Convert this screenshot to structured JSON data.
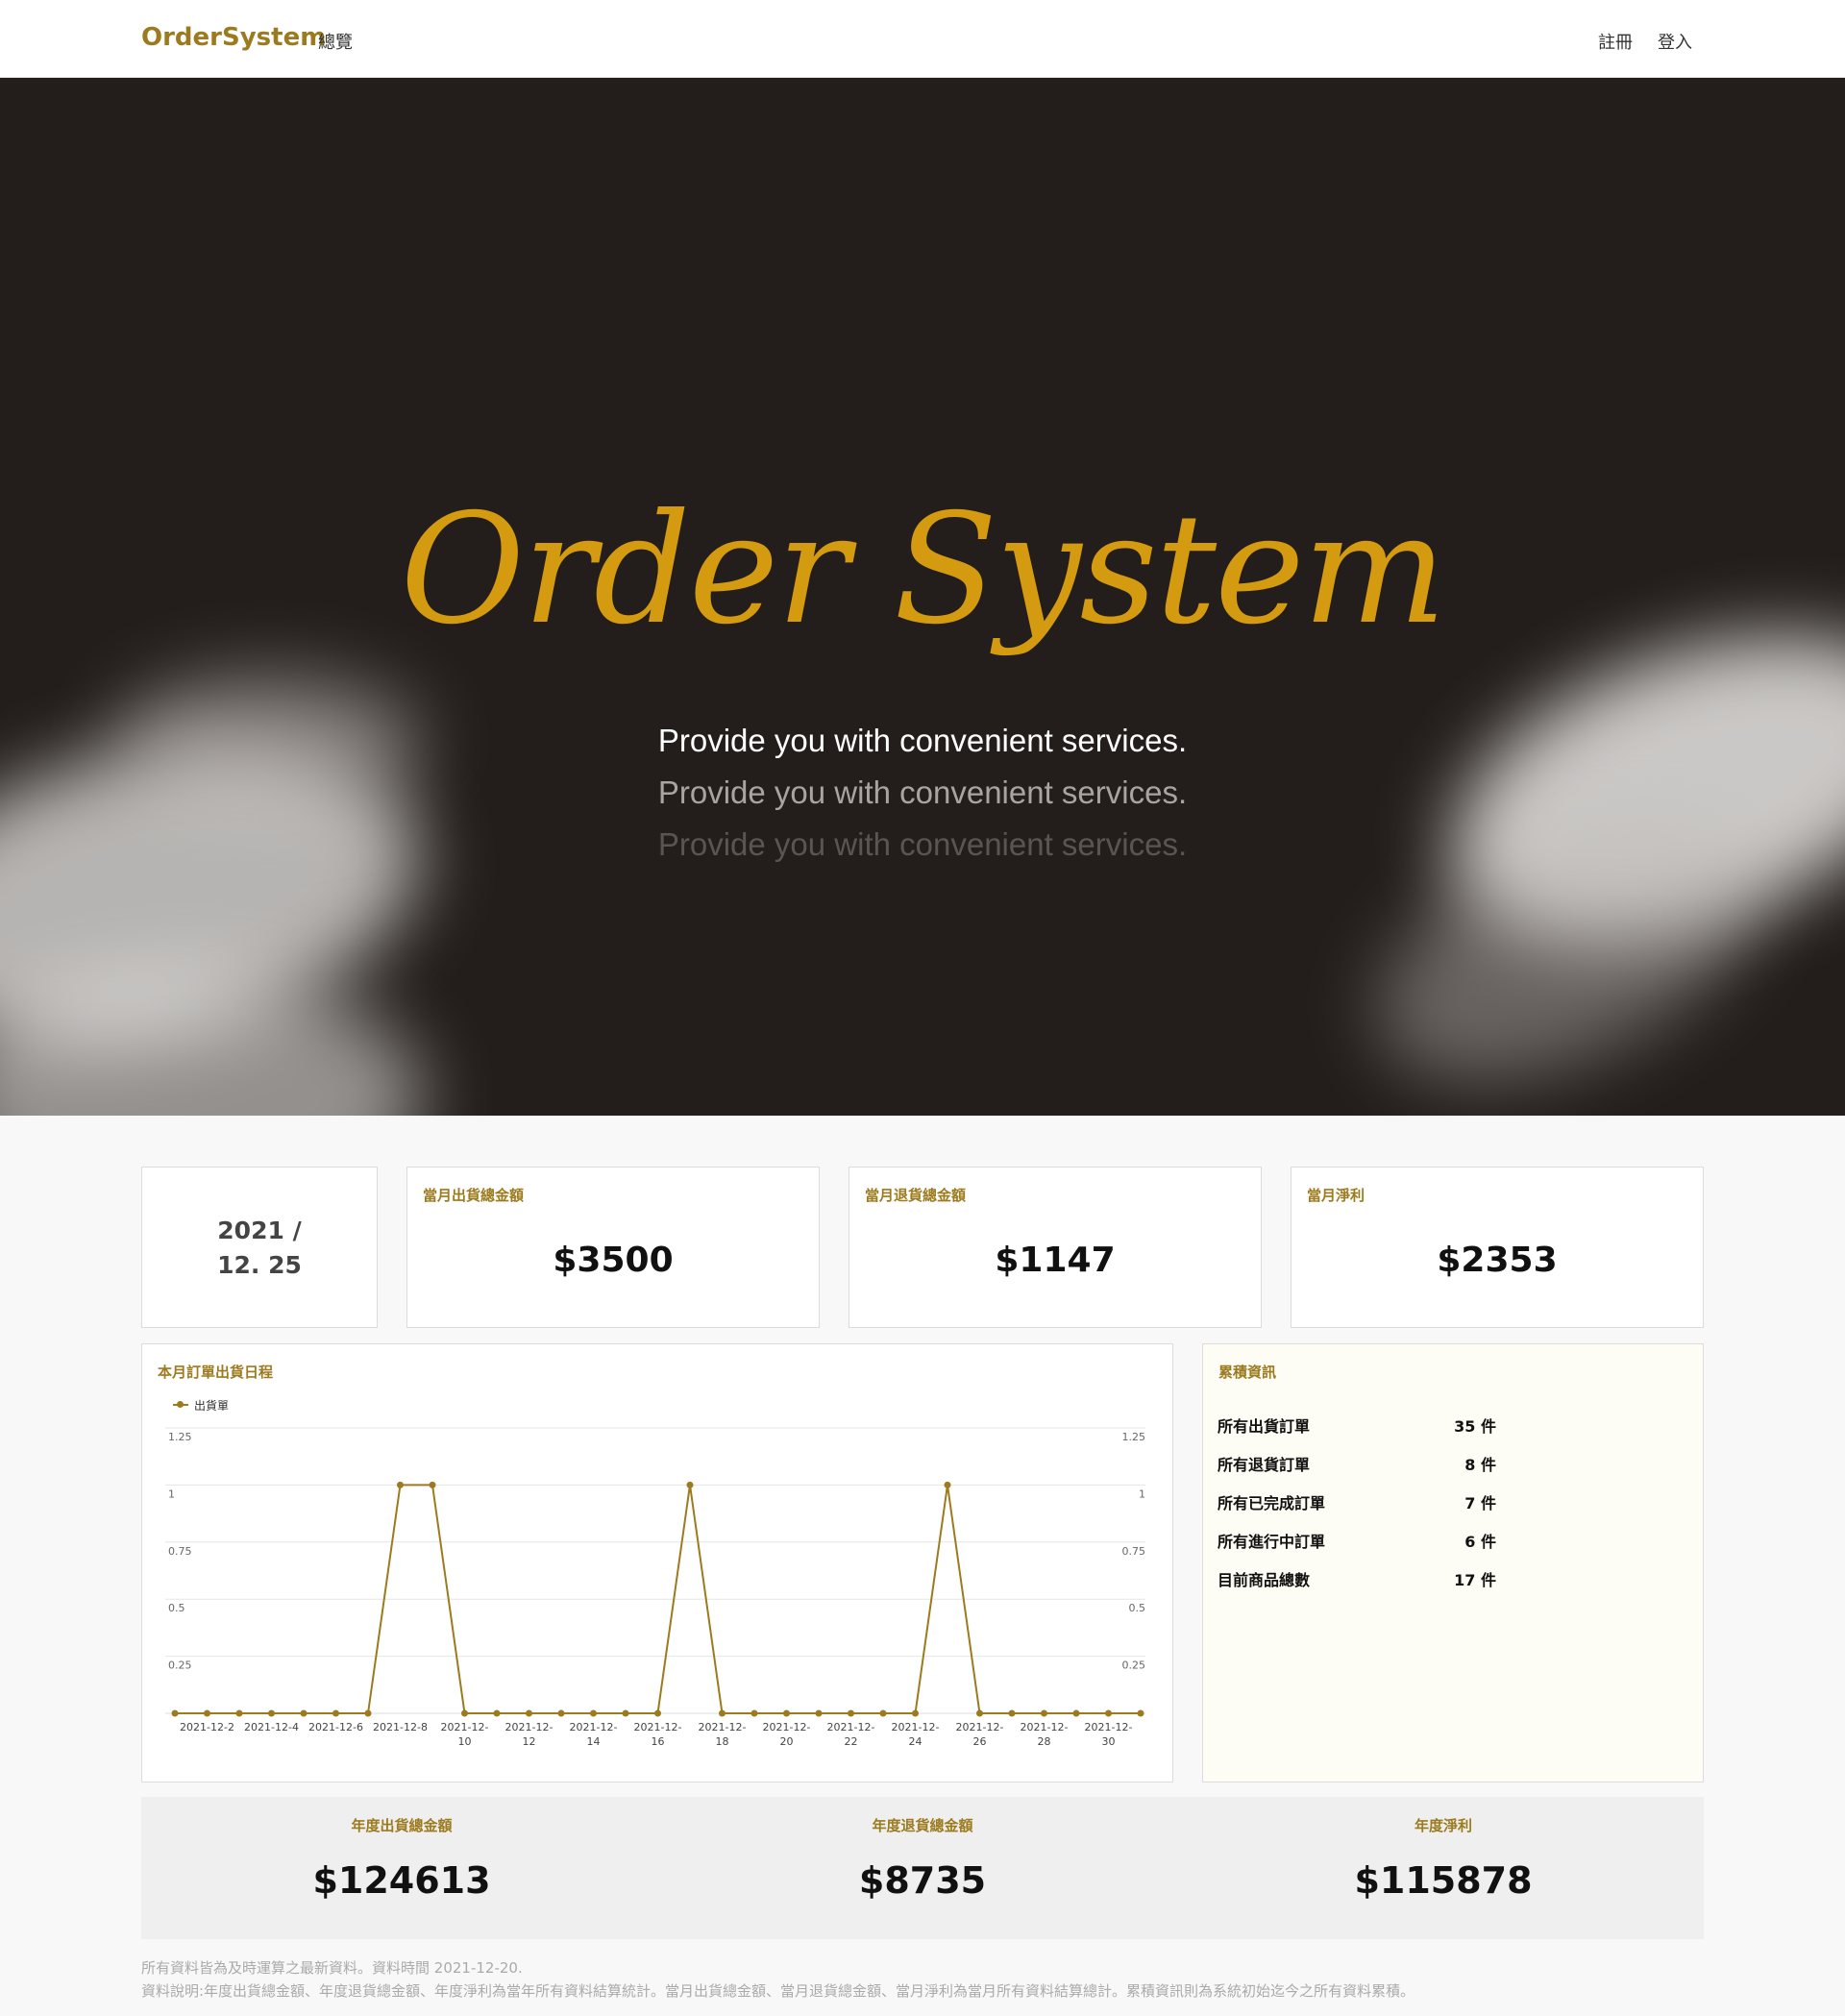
{
  "navbar": {
    "brand": "OrderSystem",
    "overview": "總覽",
    "register": "註冊",
    "login": "登入"
  },
  "hero": {
    "title": "Order System",
    "taglines": [
      "Provide you with convenient services.",
      "Provide you with convenient services.",
      "Provide you with convenient services."
    ]
  },
  "date_card": {
    "year": "2021 /",
    "day": "12. 25"
  },
  "monthly": {
    "shipment_label": "當月出貨總金額",
    "shipment_value": "$3500",
    "return_label": "當月退貨總金額",
    "return_value": "$1147",
    "profit_label": "當月淨利",
    "profit_value": "$2353"
  },
  "chart_panel": {
    "title": "本月訂單出貨日程"
  },
  "chart_data": {
    "type": "line",
    "x": [
      "2021-12-1",
      "2021-12-2",
      "2021-12-3",
      "2021-12-4",
      "2021-12-5",
      "2021-12-6",
      "2021-12-7",
      "2021-12-8",
      "2021-12-9",
      "2021-12-10",
      "2021-12-11",
      "2021-12-12",
      "2021-12-13",
      "2021-12-14",
      "2021-12-15",
      "2021-12-16",
      "2021-12-17",
      "2021-12-18",
      "2021-12-19",
      "2021-12-20",
      "2021-12-21",
      "2021-12-22",
      "2021-12-23",
      "2021-12-24",
      "2021-12-25",
      "2021-12-26",
      "2021-12-27",
      "2021-12-28",
      "2021-12-29",
      "2021-12-30",
      "2021-12-31"
    ],
    "tick_labels": [
      {
        "l1": "2021-12-2",
        "l2": ""
      },
      {
        "l1": "2021-12-4",
        "l2": ""
      },
      {
        "l1": "2021-12-6",
        "l2": ""
      },
      {
        "l1": "2021-12-8",
        "l2": ""
      },
      {
        "l1": "2021-12-",
        "l2": "10"
      },
      {
        "l1": "2021-12-",
        "l2": "12"
      },
      {
        "l1": "2021-12-",
        "l2": "14"
      },
      {
        "l1": "2021-12-",
        "l2": "16"
      },
      {
        "l1": "2021-12-",
        "l2": "18"
      },
      {
        "l1": "2021-12-",
        "l2": "20"
      },
      {
        "l1": "2021-12-",
        "l2": "22"
      },
      {
        "l1": "2021-12-",
        "l2": "24"
      },
      {
        "l1": "2021-12-",
        "l2": "26"
      },
      {
        "l1": "2021-12-",
        "l2": "28"
      },
      {
        "l1": "2021-12-",
        "l2": "30"
      }
    ],
    "series": [
      {
        "name": "出貨單",
        "values": [
          0,
          0,
          0,
          0,
          0,
          0,
          0,
          1,
          1,
          0,
          0,
          0,
          0,
          0,
          0,
          0,
          1,
          0,
          0,
          0,
          0,
          0,
          0,
          0,
          1,
          0,
          0,
          0,
          0,
          0,
          0
        ]
      }
    ],
    "yticks": [
      "1.25",
      "1",
      "0.75",
      "0.5",
      "0.25"
    ],
    "ylim": [
      0,
      1.25
    ],
    "grid": true,
    "legend": "top-left",
    "color": "#9c7a1e"
  },
  "cumulative": {
    "title": "累積資訊",
    "items": [
      {
        "label": "所有出貨訂單",
        "value": "35  件"
      },
      {
        "label": "所有退貨訂單",
        "value": "8  件"
      },
      {
        "label": "所有已完成訂單",
        "value": "7  件"
      },
      {
        "label": "所有進行中訂單",
        "value": "6  件"
      },
      {
        "label": "目前商品總數",
        "value": "17  件"
      }
    ]
  },
  "annual": {
    "shipment_label": "年度出貨總金額",
    "shipment_value": "$124613",
    "return_label": "年度退貨總金額",
    "return_value": "$8735",
    "profit_label": "年度淨利",
    "profit_value": "$115878"
  },
  "footnotes": {
    "line1": "所有資料皆為及時運算之最新資料。資料時間 2021-12-20.",
    "line2": "資料說明:年度出貨總金額、年度退貨總金額、年度淨利為當年所有資料結算統計。當月出貨總金額、當月退貨總金額、當月淨利為當月所有資料結算總計。累積資訊則為系統初始迄今之所有資料累積。"
  },
  "colors": {
    "accent": "#9c7a1e",
    "hero_bg": "#231e1c",
    "hero_title": "#d49a10"
  }
}
